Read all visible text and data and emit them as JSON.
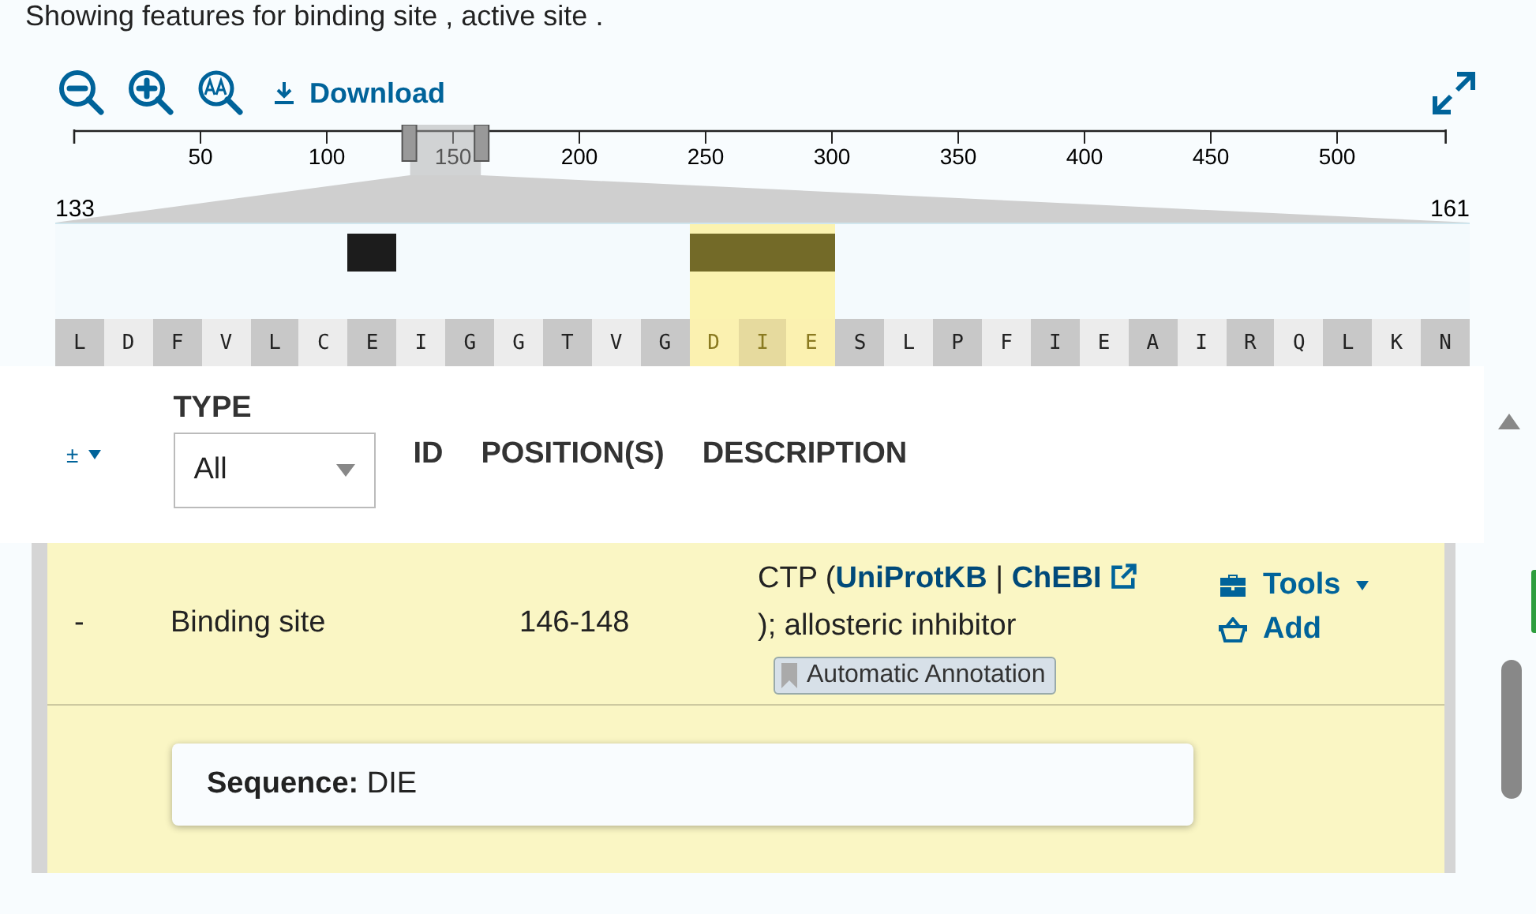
{
  "intro": "Showing features for binding site , active site .",
  "toolbar": {
    "download": "Download"
  },
  "ruler": {
    "ticks": [
      "50",
      "100",
      "150",
      "200",
      "250",
      "300",
      "350",
      "400",
      "450",
      "500"
    ],
    "range_start": "133",
    "range_end": "161"
  },
  "sequence": [
    {
      "residue": "L",
      "highlighted": false
    },
    {
      "residue": "D",
      "highlighted": false
    },
    {
      "residue": "F",
      "highlighted": false
    },
    {
      "residue": "V",
      "highlighted": false
    },
    {
      "residue": "L",
      "highlighted": false
    },
    {
      "residue": "C",
      "highlighted": false
    },
    {
      "residue": "E",
      "highlighted": false,
      "color": "#1c1c1c"
    },
    {
      "residue": "I",
      "highlighted": false
    },
    {
      "residue": "G",
      "highlighted": false
    },
    {
      "residue": "G",
      "highlighted": false
    },
    {
      "residue": "T",
      "highlighted": false
    },
    {
      "residue": "V",
      "highlighted": false
    },
    {
      "residue": "G",
      "highlighted": false
    },
    {
      "residue": "D",
      "highlighted": true,
      "color": "#736a28"
    },
    {
      "residue": "I",
      "highlighted": true,
      "color": "#736a28"
    },
    {
      "residue": "E",
      "highlighted": true,
      "color": "#736a28"
    },
    {
      "residue": "S",
      "highlighted": false
    },
    {
      "residue": "L",
      "highlighted": false
    },
    {
      "residue": "P",
      "highlighted": false
    },
    {
      "residue": "F",
      "highlighted": false
    },
    {
      "residue": "I",
      "highlighted": false
    },
    {
      "residue": "E",
      "highlighted": false
    },
    {
      "residue": "A",
      "highlighted": false
    },
    {
      "residue": "I",
      "highlighted": false
    },
    {
      "residue": "R",
      "highlighted": false
    },
    {
      "residue": "Q",
      "highlighted": false
    },
    {
      "residue": "L",
      "highlighted": false
    },
    {
      "residue": "K",
      "highlighted": false
    },
    {
      "residue": "N",
      "highlighted": false
    }
  ],
  "table": {
    "toggle": "±",
    "type_label": "TYPE",
    "type_filter": "All",
    "columns": [
      "ID",
      "POSITION(S)",
      "DESCRIPTION"
    ],
    "rows": [
      {
        "selected": true,
        "expand": "-",
        "type": "Binding site",
        "positions": "146-148",
        "ligand": "CTP (",
        "link_1": "UniProtKB",
        "separator": " | ",
        "link_2": "ChEBI",
        "description_end": " ); allosteric inhibitor",
        "badge": "Automatic Annotation",
        "tools": "Tools",
        "add": "Add",
        "detail_label": "Sequence:",
        "detail_value": "DIE"
      }
    ]
  }
}
